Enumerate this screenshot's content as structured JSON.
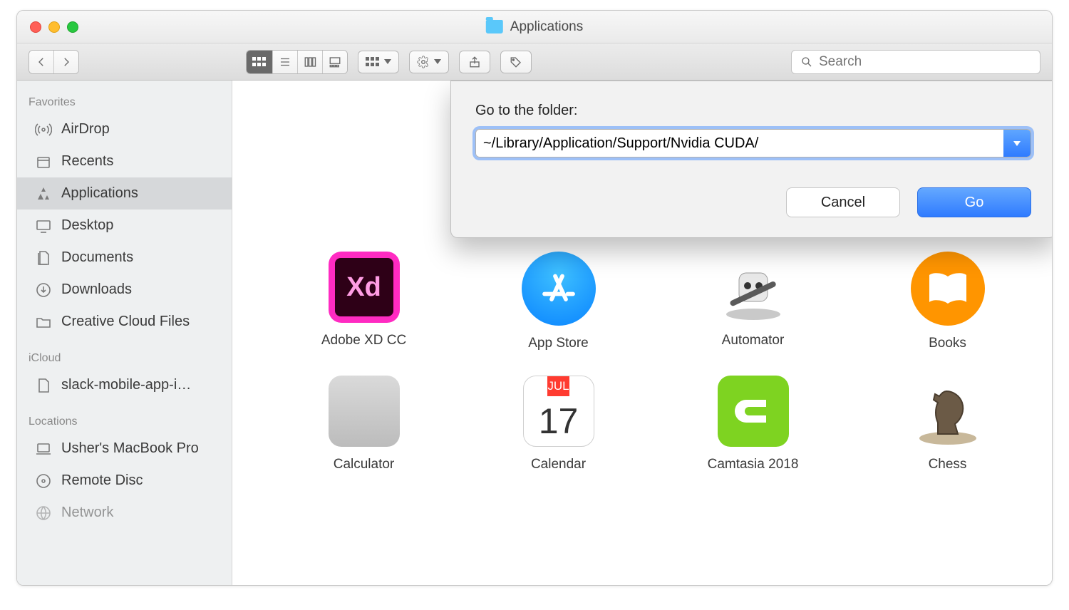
{
  "window_title": "Applications",
  "search_placeholder": "Search",
  "sidebar": {
    "favorites_header": "Favorites",
    "icloud_header": "iCloud",
    "locations_header": "Locations",
    "items": {
      "airdrop": "AirDrop",
      "recents": "Recents",
      "applications": "Applications",
      "desktop": "Desktop",
      "documents": "Documents",
      "downloads": "Downloads",
      "creative": "Creative Cloud Files",
      "slack": "slack-mobile-app-i…",
      "macbook": "Usher's MacBook Pro",
      "remote": "Remote Disc",
      "network": "Network"
    }
  },
  "dialog": {
    "label": "Go to the folder:",
    "value": "~/Library/Application/Support/Nvidia CUDA/",
    "cancel": "Cancel",
    "go": "Go"
  },
  "apps": {
    "adobe_xd": "Adobe XD",
    "adobe_xd_cc": "Adobe XD CC",
    "app_store": "App Store",
    "automator": "Automator",
    "books": "Books",
    "calculator": "Calculator",
    "calendar": "Calendar",
    "calendar_month": "JUL",
    "calendar_day": "17",
    "camtasia": "Camtasia 2018",
    "chess": "Chess",
    "xd_glyph": "Xd"
  }
}
